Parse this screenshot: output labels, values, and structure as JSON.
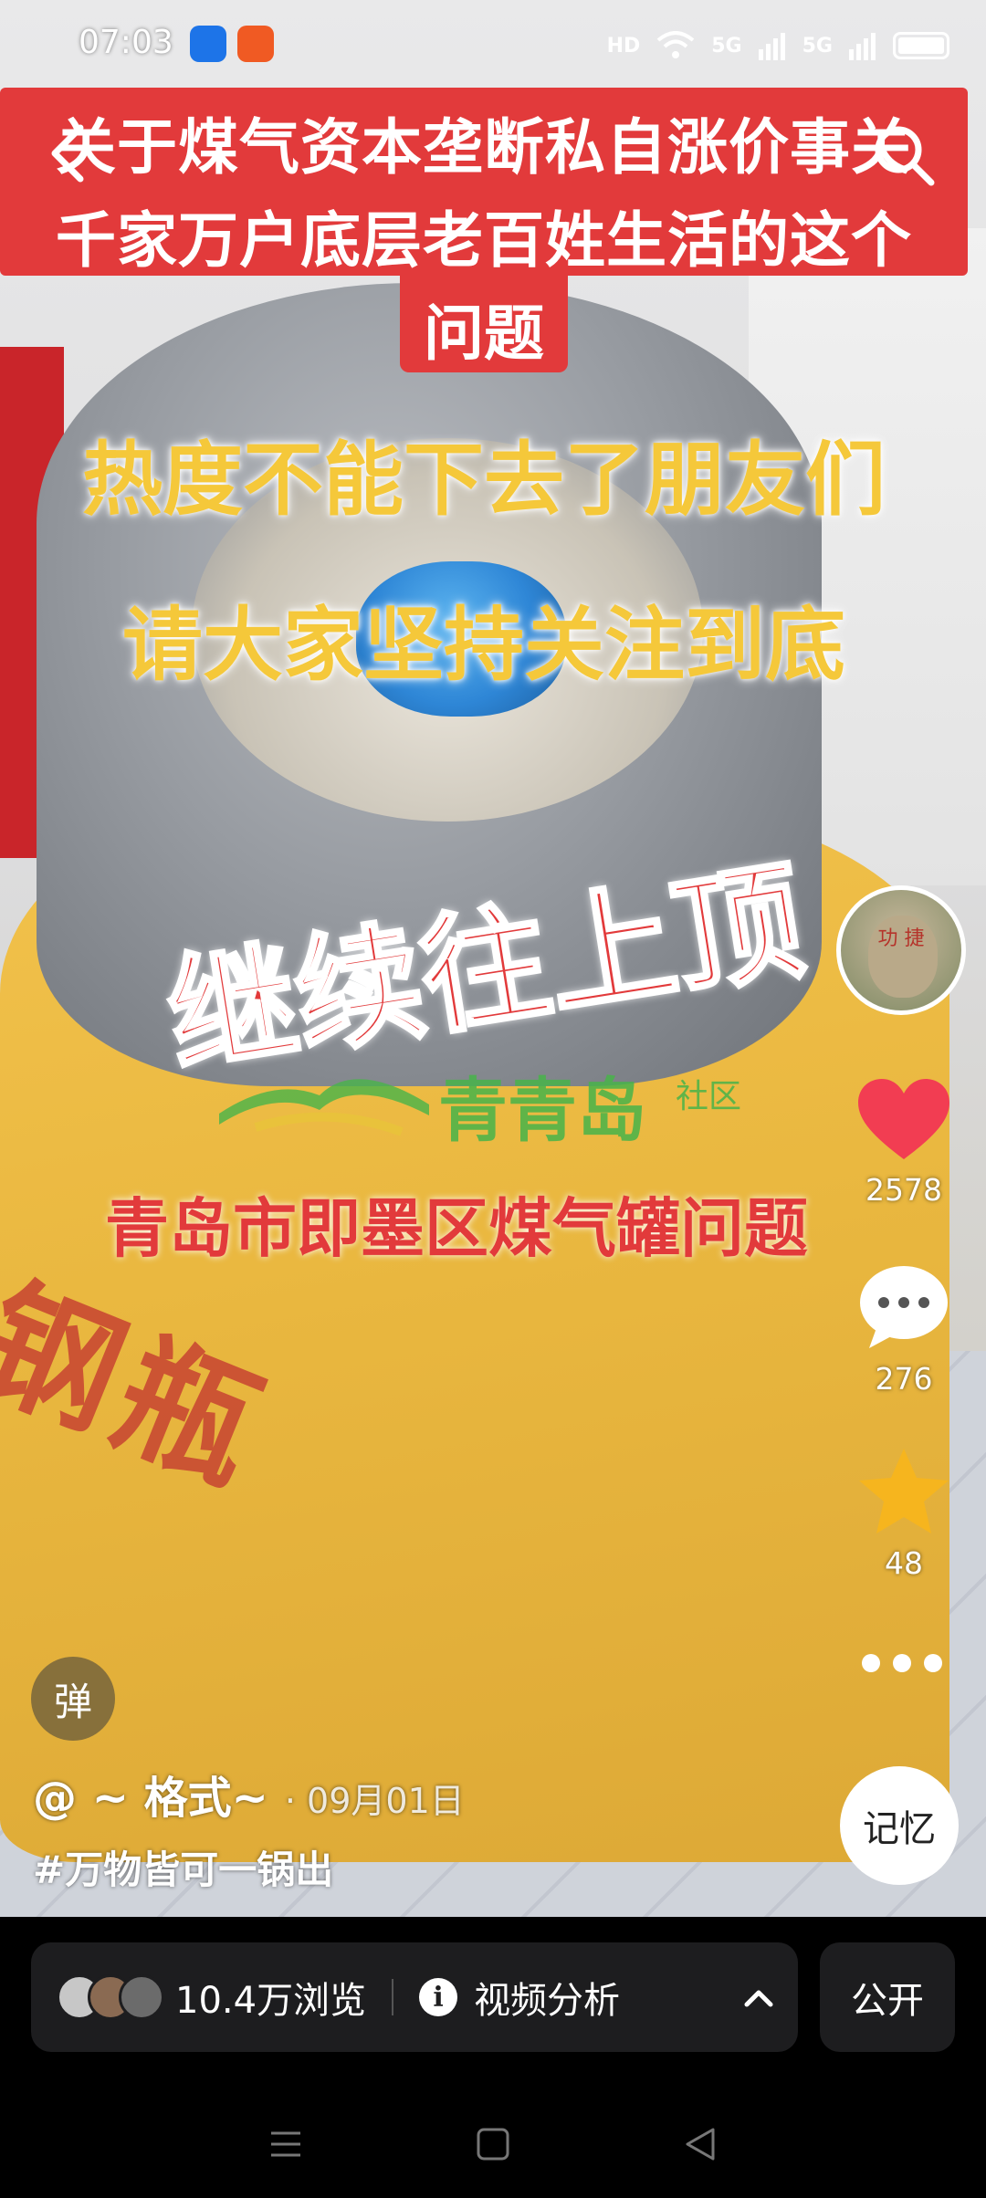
{
  "status_bar": {
    "time": "07:03",
    "hd_label": "HD",
    "net1": "5G",
    "net2": "5G"
  },
  "video": {
    "title_line1": "关于煤气资本垄断私自涨价事关",
    "title_line2": "千家万户底层老百姓生活的这个",
    "title_line3": "问题",
    "heat_line1": "热度不能下去了朋友们",
    "heat_line2": "请大家坚持关注到底",
    "push_text": "继续往上顶",
    "watermark_name": "青青岛",
    "watermark_sub": "社区",
    "city_text": "青岛市即墨区煤气罐问题",
    "bag_text": "钢瓶"
  },
  "rail": {
    "avatar_text": "功 捷",
    "likes": "2578",
    "comments": "276",
    "favorites": "48",
    "music_text": "记忆"
  },
  "meta": {
    "danmu_label": "弹",
    "author": "@ ~ 格式~",
    "date": "· 09月01日",
    "hashtag": "#万物皆可一锅出"
  },
  "panel": {
    "views": "10.4万浏览",
    "analysis": "视频分析",
    "public_label": "公开"
  },
  "colors": {
    "title_bg": "#e23a3b",
    "heat_text": "#f5c83a",
    "like_red": "#f23d52",
    "fav_gold": "#f6b51e",
    "panel_bg": "#1d1d1f"
  }
}
